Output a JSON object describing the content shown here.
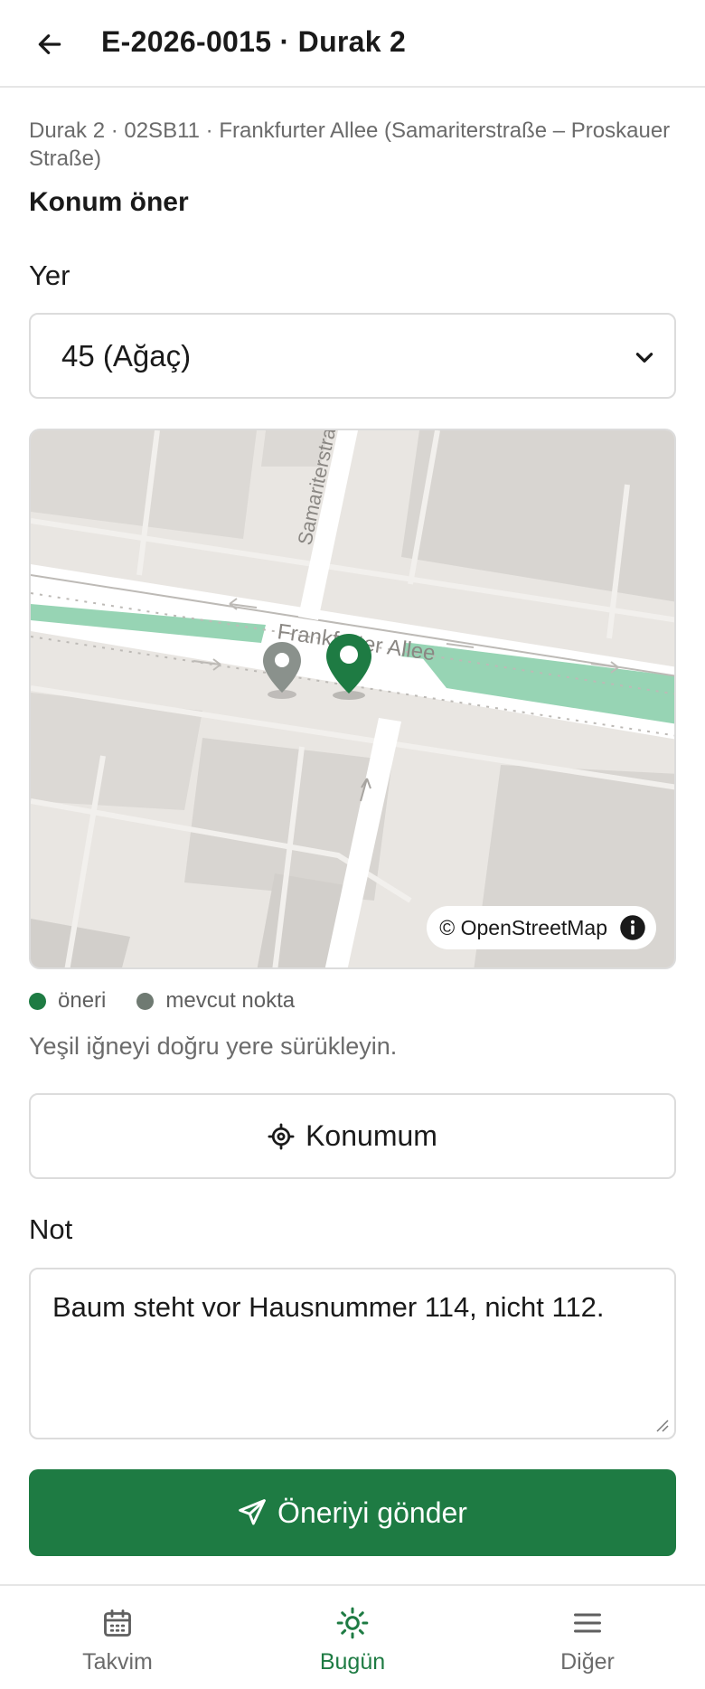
{
  "header": {
    "title": "E-2026-0015 · Durak 2"
  },
  "breadcrumb": "Durak 2 · 02SB11 · Frankfurter Allee (Samariterstraße – Proskauer Straße)",
  "section_title": "Konum öner",
  "place": {
    "label": "Yer",
    "selected": "45 (Ağaç)"
  },
  "map": {
    "street_labels": [
      "Samariterstraße",
      "Frankfurter Allee"
    ],
    "attribution": "© OpenStreetMap",
    "colors": {
      "suggestion_pin": "#1e7b43",
      "existing_pin": "#8a918c"
    }
  },
  "legend": {
    "suggestion": "öneri",
    "existing": "mevcut nokta",
    "suggestion_color": "#1e7b43",
    "existing_color": "#6f7a72"
  },
  "hint": "Yeşil iğneyi doğru yere sürükleyin.",
  "locate_button": "Konumum",
  "note": {
    "label": "Not",
    "value": "Baum steht vor Hausnummer 114, nicht 112."
  },
  "submit_button": "Öneriyi gönder",
  "bottom_nav": {
    "items": [
      {
        "label": "Takvim",
        "icon": "calendar-icon"
      },
      {
        "label": "Bugün",
        "icon": "sun-icon",
        "active": true
      },
      {
        "label": "Diğer",
        "icon": "menu-icon"
      }
    ]
  },
  "accent_color": "#1e7b43"
}
